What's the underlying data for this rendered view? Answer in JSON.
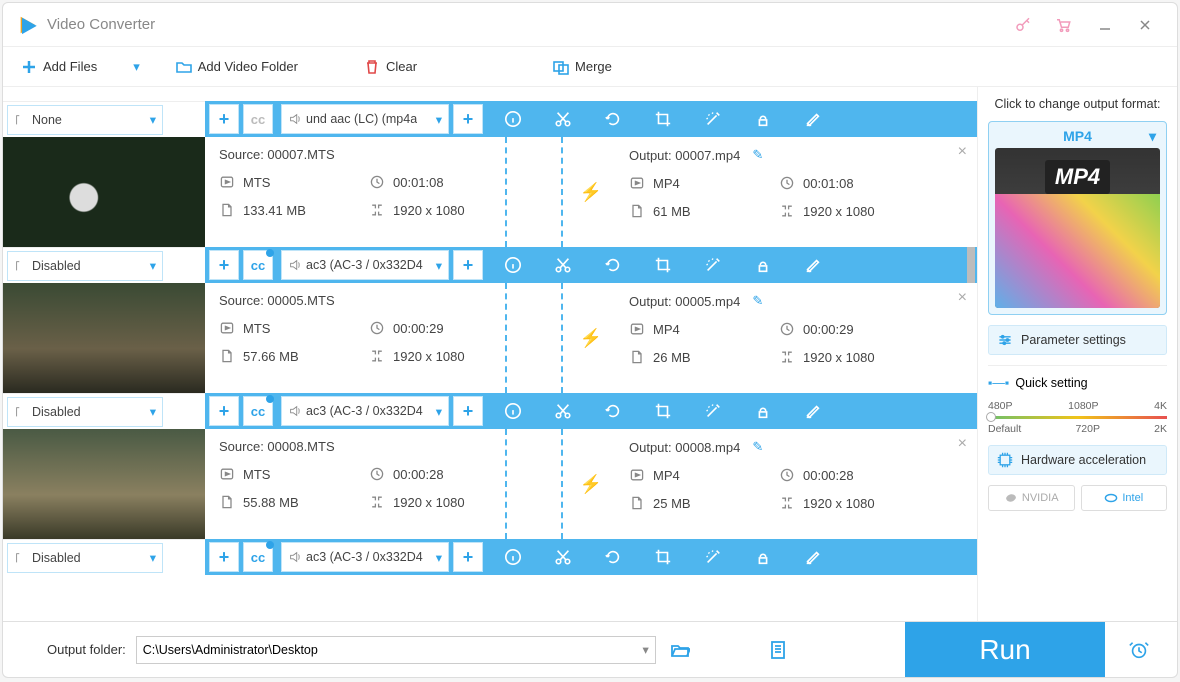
{
  "app": {
    "title": "Video Converter"
  },
  "toolbar": {
    "add_files": "Add Files",
    "add_folder": "Add Video Folder",
    "clear": "Clear",
    "merge": "Merge"
  },
  "rows": [
    {
      "sub": "None",
      "cc_gear": false,
      "audio": "und aac (LC) (mp4a"
    },
    {
      "src_label": "Source: 00007.MTS",
      "out_label": "Output: 00007.mp4",
      "src_fmt": "MTS",
      "src_dur": "00:01:08",
      "src_size": "133.41 MB",
      "src_res": "1920 x 1080",
      "out_fmt": "MP4",
      "out_dur": "00:01:08",
      "out_size": "61 MB",
      "out_res": "1920 x 1080",
      "sub": "Disabled",
      "cc_gear": true,
      "audio": "ac3 (AC-3 / 0x332D4"
    },
    {
      "src_label": "Source: 00005.MTS",
      "out_label": "Output: 00005.mp4",
      "src_fmt": "MTS",
      "src_dur": "00:00:29",
      "src_size": "57.66 MB",
      "src_res": "1920 x 1080",
      "out_fmt": "MP4",
      "out_dur": "00:00:29",
      "out_size": "26 MB",
      "out_res": "1920 x 1080",
      "sub": "Disabled",
      "cc_gear": true,
      "audio": "ac3 (AC-3 / 0x332D4"
    },
    {
      "src_label": "Source: 00008.MTS",
      "out_label": "Output: 00008.mp4",
      "src_fmt": "MTS",
      "src_dur": "00:00:28",
      "src_size": "55.88 MB",
      "src_res": "1920 x 1080",
      "out_fmt": "MP4",
      "out_dur": "00:00:28",
      "out_size": "25 MB",
      "out_res": "1920 x 1080",
      "sub": "Disabled",
      "cc_gear": true,
      "audio": "ac3 (AC-3 / 0x332D4"
    }
  ],
  "side": {
    "click_change": "Click to change output format:",
    "fmt": "MP4",
    "param": "Parameter settings",
    "quick": "Quick setting",
    "marks_top": [
      "480P",
      "1080P",
      "4K"
    ],
    "marks_bot": [
      "Default",
      "720P",
      "2K"
    ],
    "hw": "Hardware acceleration",
    "nvidia": "NVIDIA",
    "intel": "Intel"
  },
  "bottom": {
    "label": "Output folder:",
    "path": "C:\\Users\\Administrator\\Desktop",
    "run": "Run"
  }
}
